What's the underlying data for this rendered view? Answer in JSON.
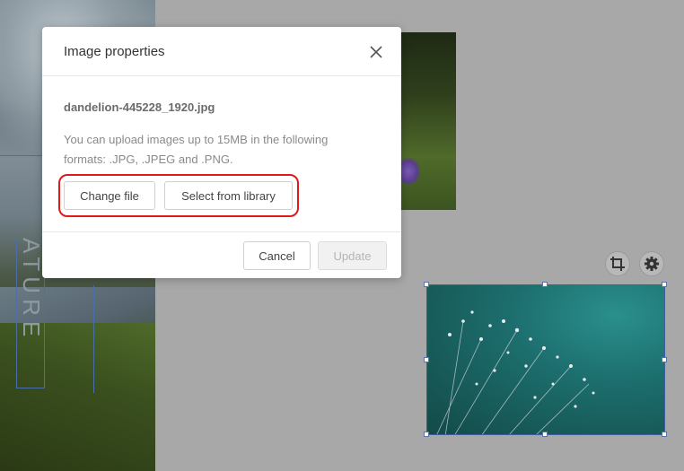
{
  "modal": {
    "title": "Image properties",
    "close_label": "X",
    "file_name": "dandelion-445228_1920.jpg",
    "help_text": "You can upload images up to 15MB in the following formats: .JPG, .JPEG and .PNG.",
    "change_file_label": "Change file",
    "select_library_label": "Select from library",
    "cancel_label": "Cancel",
    "update_label": "Update",
    "update_disabled": true
  },
  "canvas": {
    "vertical_text": "ATURE",
    "toolbar_icons": [
      "crop-icon",
      "gear-icon"
    ]
  },
  "colors": {
    "highlight": "#e0191b",
    "overlay": "#a8a8a8",
    "selection": "#4b6fa8"
  }
}
